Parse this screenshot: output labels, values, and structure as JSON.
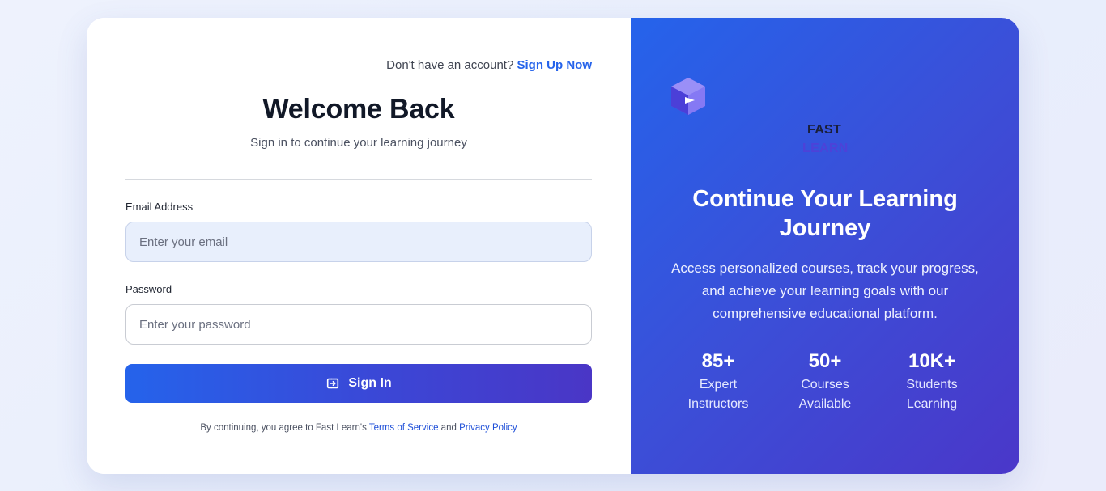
{
  "auth": {
    "signup_prompt": "Don't have an account?",
    "signup_link": "Sign Up Now",
    "title": "Welcome Back",
    "subtitle": "Sign in to continue your learning journey"
  },
  "form": {
    "email_label": "Email Address",
    "email_placeholder": "Enter your email",
    "email_value": "",
    "password_label": "Password",
    "password_placeholder": "Enter your password",
    "password_value": "",
    "submit_label": "Sign In",
    "submit_icon": "login-icon"
  },
  "terms": {
    "prefix": "By continuing, you agree to Fast Learn's",
    "terms_link": "Terms of Service",
    "conjunction": "and",
    "privacy_link": "Privacy Policy"
  },
  "promo": {
    "logo_icon": "cube-play-icon",
    "brand_line1": "FAST",
    "brand_line2": "LEARN",
    "title": "Continue Your Learning Journey",
    "description": "Access personalized courses, track your progress, and achieve your learning goals with our comprehensive educational platform.",
    "stats": [
      {
        "value": "85+",
        "label": "Expert Instructors"
      },
      {
        "value": "50+",
        "label": "Courses Available"
      },
      {
        "value": "10K+",
        "label": "Students Learning"
      }
    ]
  },
  "colors": {
    "accent": "#2563eb",
    "gradient_end": "#4a36c6",
    "page_background": "#eef2fd"
  }
}
